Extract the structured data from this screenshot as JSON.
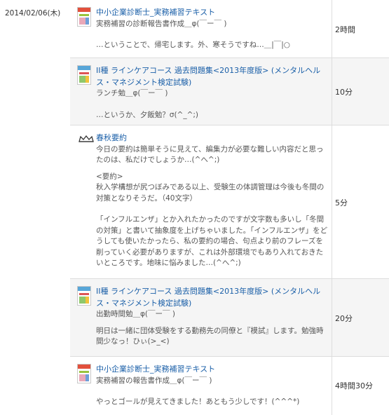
{
  "date": "2014/02/06(木)",
  "entries": [
    {
      "title": "中小企業診断士_実務補習テキスト",
      "subtitle": "実務補習の診断報告書作成＿φ(￣ー￣ )",
      "note": "…ということで、帰宅します。外、寒そうですね…＿|￣|○",
      "time": "2時間",
      "icon": "book-cover"
    },
    {
      "title": "II種 ラインケアコース 過去問題集<2013年度版> (メンタルヘルス・マネジメント検定試験)",
      "subtitle": "ランチ勉＿φ(￣ー￣ )",
      "note": "…というか、夕飯勉？σ(^_^;)",
      "time": "10分",
      "icon": "book-cover"
    },
    {
      "title": "春秋要約",
      "subtitle": "今日の要約は簡単そうに見えて、編集力が必要な難しい内容だと思ったのは、私だけでしょうか…(^へ^;)",
      "summary_label": "<要約>",
      "summary": "秋入学構想が尻つぼみである以上、受験生の体調管理は今後も冬間の対策となりそうだ。（40文字）",
      "note": "「インフルエンザ」とか入れたかったのですが文字数も多いし「冬間の対策」と書いて抽象度を上げちゃいました。「インフルエンザ」をどうしても使いたかったら、私の要約の場合、句点より前のフレーズを削っていく必要がありますが、これは外部環境でもあり入れておきたいところです。地味に悩みました…(^へ^;)",
      "time": "5分",
      "icon": "crown-icon"
    },
    {
      "title": "II種 ラインケアコース 過去問題集<2013年度版> (メンタルヘルス・マネジメント検定試験)",
      "subtitle": "出勤時間勉＿φ(￣ー￣ )",
      "note": "明日は一緒に団体受験をする勤務先の同僚と『模試』します。勉強時間少なっ！ひぃ(>_<)",
      "time": "20分",
      "icon": "book-cover"
    },
    {
      "title": "中小企業診断士_実務補習テキスト",
      "subtitle": "実務補習の報告書作成＿φ(￣ー￣ )",
      "note": "やっとゴールが見えてきました！あともう少しです！(^^^*)",
      "time": "4時間30分",
      "icon": "book-cover"
    }
  ],
  "colors": {
    "link": "#1a5fa8",
    "border": "#dddddd",
    "alt_row": "#f5f5f5"
  }
}
